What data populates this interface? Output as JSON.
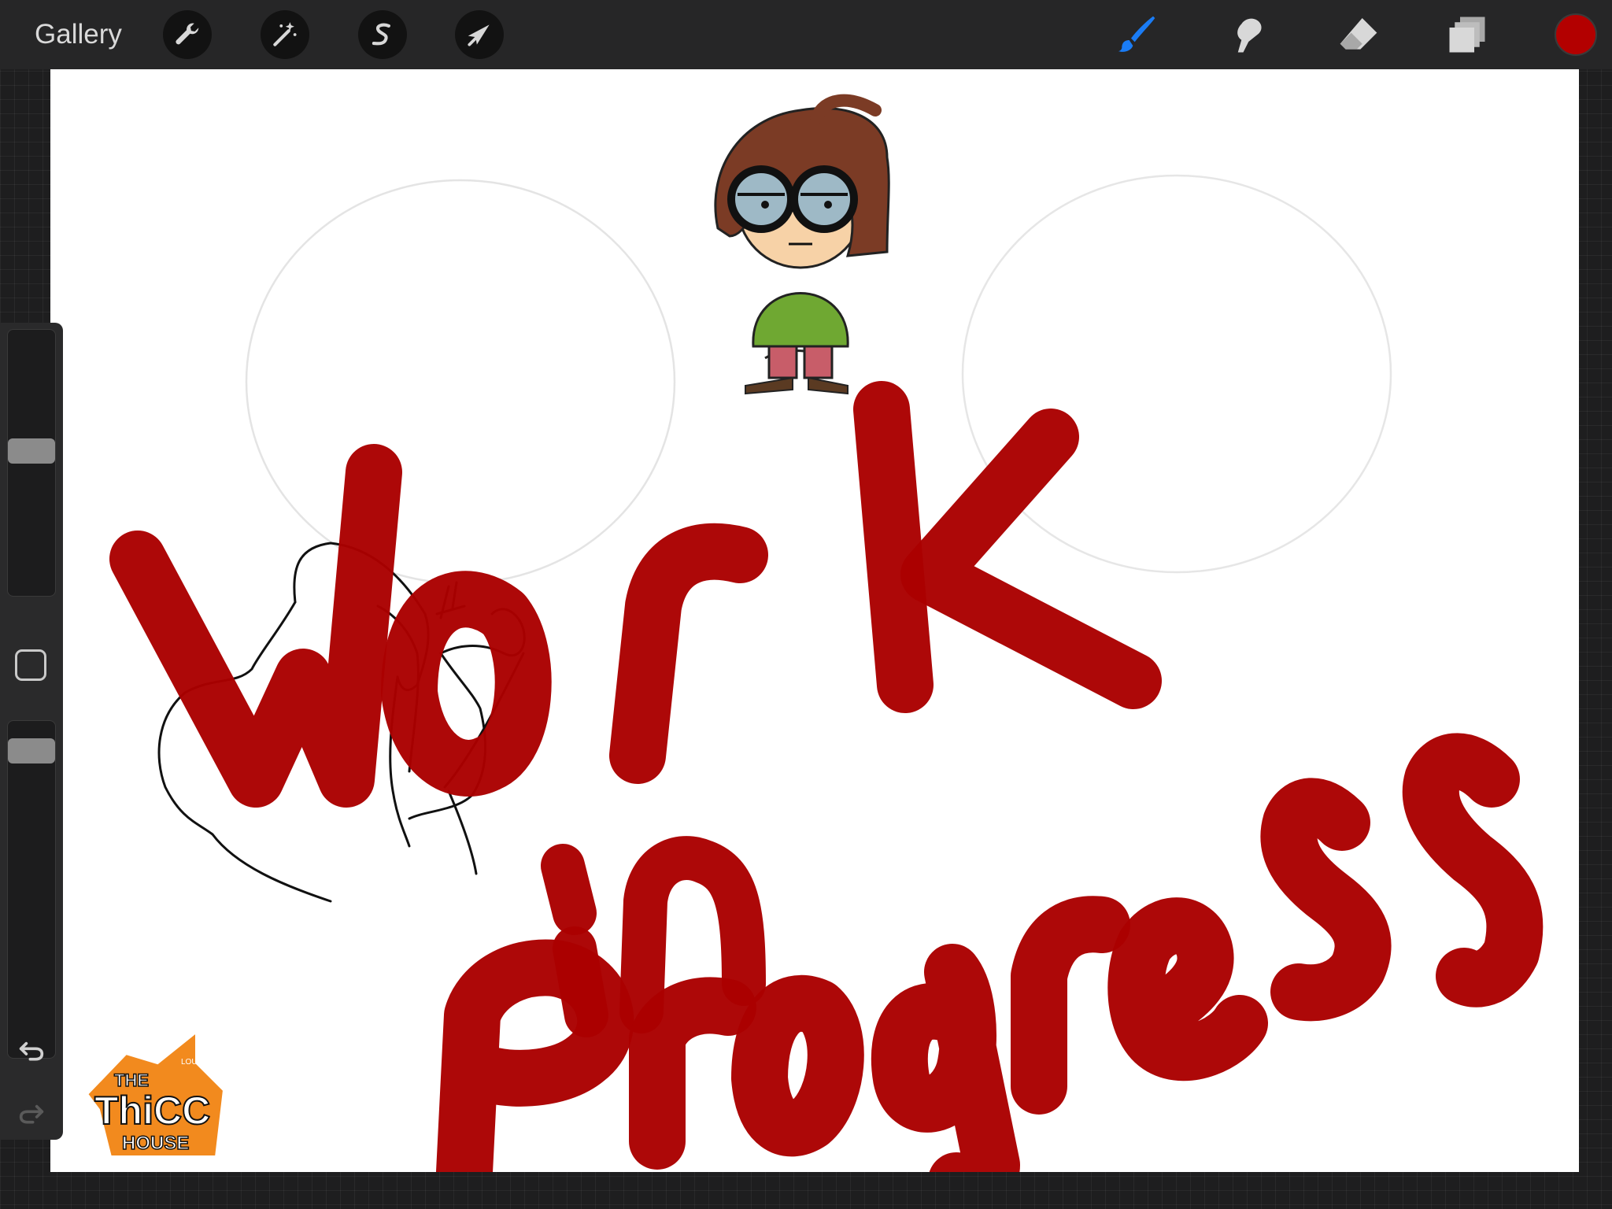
{
  "toolbar": {
    "gallery_label": "Gallery",
    "left_tools": [
      {
        "name": "actions",
        "icon": "wrench-icon"
      },
      {
        "name": "adjustments",
        "icon": "magic-wand-icon"
      },
      {
        "name": "selection",
        "icon": "selection-s-icon"
      },
      {
        "name": "transform",
        "icon": "arrow-cursor-icon"
      }
    ],
    "right_tools": [
      {
        "name": "brush",
        "icon": "brush-icon",
        "active": true
      },
      {
        "name": "smudge",
        "icon": "smudge-finger-icon",
        "active": false
      },
      {
        "name": "eraser",
        "icon": "eraser-icon",
        "active": false
      },
      {
        "name": "layers",
        "icon": "layers-icon",
        "active": false
      }
    ],
    "current_color": "#b30000",
    "active_tool_color": "#1a7cf5"
  },
  "sidebar": {
    "brush_size_level": 0.55,
    "brush_opacity_level": 0.95,
    "undo_icon": "undo-arrow-icon",
    "redo_icon": "redo-arrow-icon"
  },
  "canvas": {
    "lettering": [
      "Work",
      "in",
      "Progress"
    ],
    "paint_color": "#aa0000",
    "logo": {
      "top": "THE",
      "small": "LOUD",
      "middle": "ThiCC",
      "bottom": "HOUSE",
      "color": "#f28a1e"
    }
  }
}
